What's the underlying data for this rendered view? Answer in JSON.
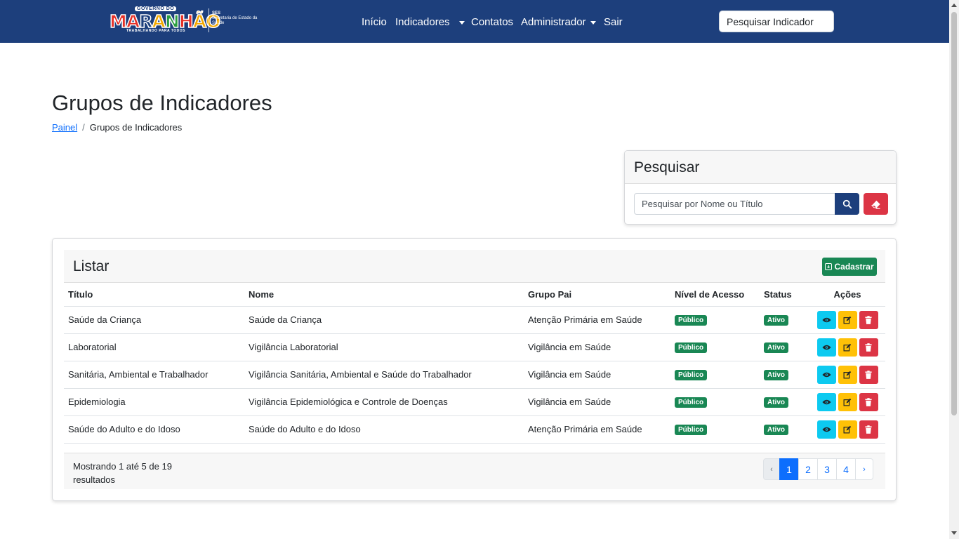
{
  "header": {
    "logo": {
      "top": "GOVERNO DO",
      "word": "MARANHÃO",
      "bottom": "TRABALHANDO PARA TODOS",
      "ses": "SES",
      "ses_sub": "Secretaria de Estado da Saúde"
    },
    "nav": {
      "inicio": "Início",
      "indicadores": "Indicadores",
      "contatos": "Contatos",
      "administrador": "Administrador",
      "sair": "Sair"
    },
    "search_placeholder": "Pesquisar Indicador"
  },
  "page": {
    "title": "Grupos de Indicadores",
    "breadcrumb": {
      "home": "Painel",
      "current": "Grupos de Indicadores"
    }
  },
  "search_card": {
    "title": "Pesquisar",
    "placeholder": "Pesquisar por Nome ou Título"
  },
  "list_card": {
    "title": "Listar",
    "add_label": "Cadastrar",
    "columns": {
      "titulo": "Título",
      "nome": "Nome",
      "grupo_pai": "Grupo Pai",
      "nivel": "Nível de Acesso",
      "status": "Status",
      "acoes": "Ações"
    },
    "rows": [
      {
        "titulo": "Saúde da Criança",
        "nome": "Saúde da Criança",
        "grupo_pai": "Atenção Primária em Saúde",
        "nivel": "Público",
        "status": "Ativo"
      },
      {
        "titulo": "Laboratorial",
        "nome": "Vigilância Laboratorial",
        "grupo_pai": "Vigilância em Saúde",
        "nivel": "Público",
        "status": "Ativo"
      },
      {
        "titulo": "Sanitária, Ambiental e Trabalhador",
        "nome": "Vigilância Sanitária, Ambiental e Saúde do Trabalhador",
        "grupo_pai": "Vigilância em Saúde",
        "nivel": "Público",
        "status": "Ativo"
      },
      {
        "titulo": "Epidemiologia",
        "nome": "Vigilância Epidemiológica e Controle de Doenças",
        "grupo_pai": "Vigilância em Saúde",
        "nivel": "Público",
        "status": "Ativo"
      },
      {
        "titulo": "Saúde do Adulto e do Idoso",
        "nome": "Saúde do Adulto e do Idoso",
        "grupo_pai": "Atenção Primária em Saúde",
        "nivel": "Público",
        "status": "Ativo"
      }
    ],
    "footer_text": "Mostrando 1 até 5 de 19 resultados",
    "pagination": {
      "prev": "‹",
      "pages": [
        "1",
        "2",
        "3",
        "4"
      ],
      "next": "›",
      "active": "1"
    }
  },
  "colors": {
    "navbar": "#1d3f7c",
    "success": "#198754",
    "info": "#0dcaf0",
    "warning": "#ffc107",
    "danger": "#dc3545",
    "primary": "#0d6efd"
  }
}
